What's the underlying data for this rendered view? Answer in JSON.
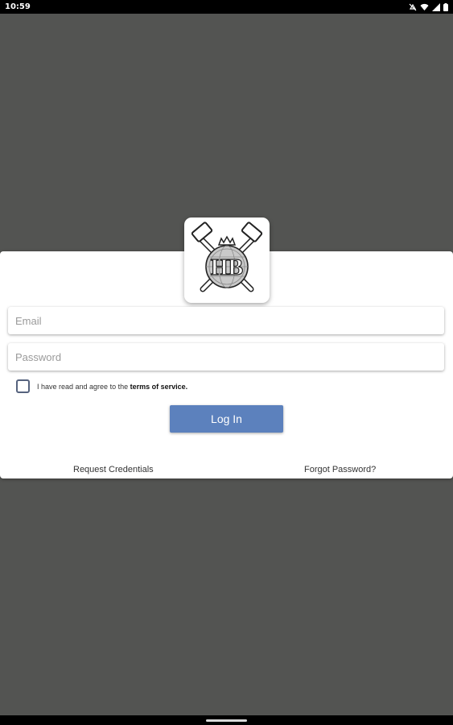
{
  "status_bar": {
    "time": "10:59",
    "icons": [
      "notification-off-icon",
      "wifi-icon",
      "signal-icon",
      "battery-icon"
    ]
  },
  "logo": {
    "text": "HB"
  },
  "form": {
    "email_placeholder": "Email",
    "password_placeholder": "Password",
    "terms_prefix": "I have read and agree to the ",
    "terms_link": "terms of service.",
    "terms_checked": false,
    "login_label": "Log In"
  },
  "footer": {
    "request_credentials": "Request Credentials",
    "forgot_password": "Forgot Password?"
  },
  "colors": {
    "background": "#535452",
    "accent": "#5c81bd",
    "card": "#ffffff"
  }
}
